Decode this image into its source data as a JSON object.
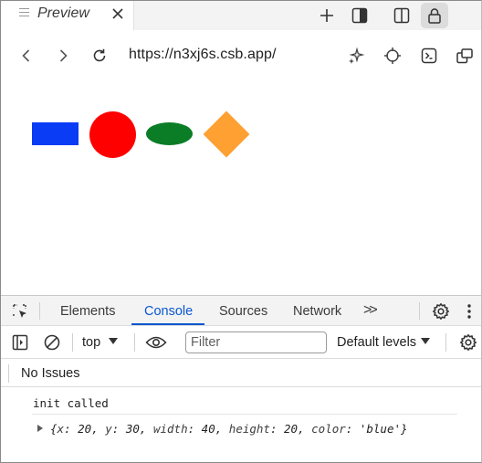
{
  "tab": {
    "title": "Preview"
  },
  "nav": {
    "url": "https://n3xj6s.csb.app/"
  },
  "shapes": {
    "rectangle_color": "#0a3cf5",
    "circle_color": "#ff0000",
    "ellipse_color": "#0b7d27",
    "diamond_color": "#ffa033"
  },
  "devtools": {
    "tabs": [
      {
        "label": "Elements"
      },
      {
        "label": "Console"
      },
      {
        "label": "Sources"
      },
      {
        "label": "Network"
      }
    ],
    "more_label": ">>",
    "active_tab": "Console",
    "context": "top",
    "filter_placeholder": "Filter",
    "levels": "Default levels",
    "issues": "No Issues",
    "console": {
      "log1": "init called",
      "obj": {
        "open": "{",
        "x_key": "x",
        "x_val": "20",
        "y_key": "y",
        "y_val": "30",
        "w_key": "width",
        "w_val": "40",
        "h_key": "height",
        "h_val": "20",
        "c_key": "color",
        "c_val": "'blue'",
        "close": "}"
      }
    }
  },
  "colors": {
    "accent": "#0b57d0"
  }
}
